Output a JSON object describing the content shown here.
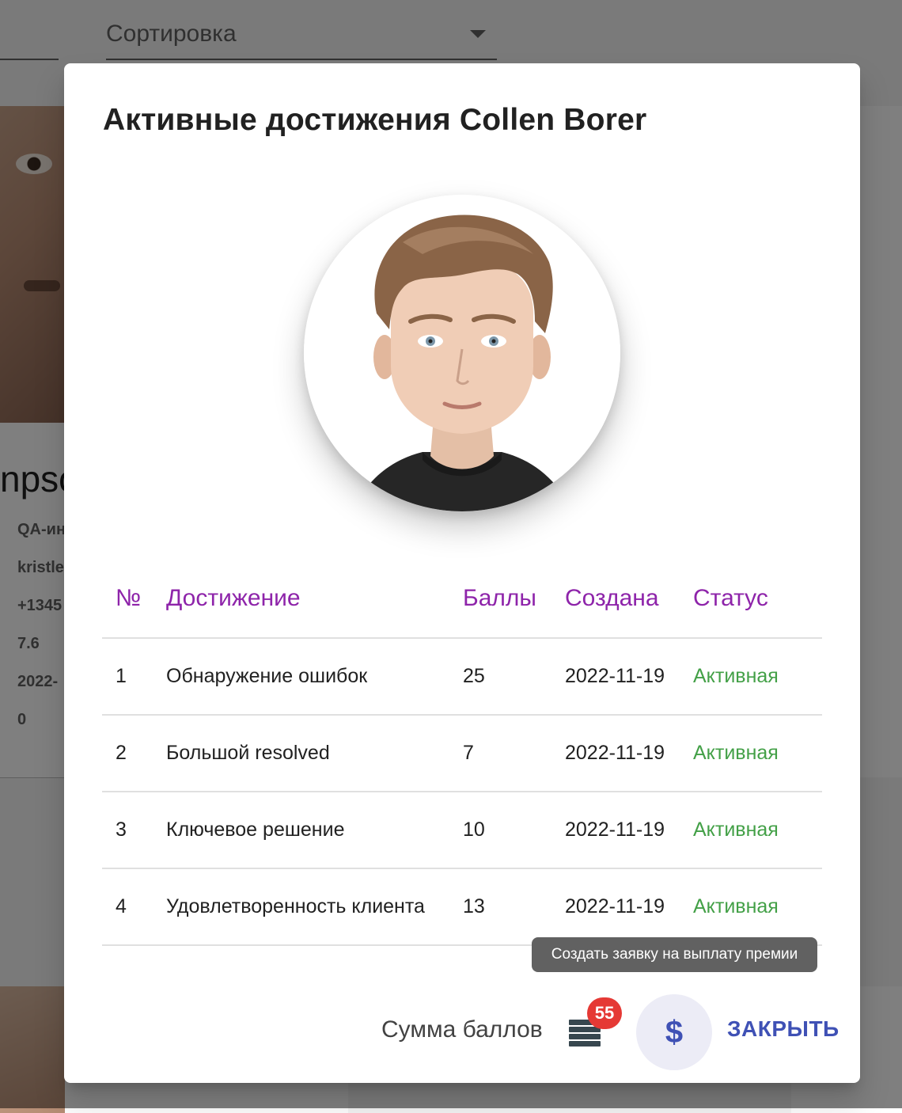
{
  "background": {
    "sort_label": "Сортировка",
    "card": {
      "name_fragment": "npso",
      "lines": [
        "QA-ин",
        "kristle",
        "+1345",
        "7.6",
        "2022-",
        "0"
      ]
    }
  },
  "dialog": {
    "title": "Активные достижения Collen Borer",
    "table": {
      "headers": [
        "№",
        "Достижение",
        "Баллы",
        "Создана",
        "Статус"
      ],
      "rows": [
        {
          "n": "1",
          "achievement": "Обнаружение ошибок",
          "points": "25",
          "created": "2022-11-19",
          "status": "Активная"
        },
        {
          "n": "2",
          "achievement": "Большой resolved",
          "points": "7",
          "created": "2022-11-19",
          "status": "Активная"
        },
        {
          "n": "3",
          "achievement": "Ключевое решение",
          "points": "10",
          "created": "2022-11-19",
          "status": "Активная"
        },
        {
          "n": "4",
          "achievement": "Удовлетворенность клиента",
          "points": "13",
          "created": "2022-11-19",
          "status": "Активная"
        }
      ]
    },
    "tooltip": "Создать заявку на выплату премии",
    "sum_label": "Сумма баллов",
    "sum_badge": "55",
    "payout_icon": "dollar-icon",
    "payout_symbol": "$",
    "close_label": "ЗАКРЫТЬ"
  },
  "colors": {
    "header_text": "#8e24aa",
    "status_active": "#43a047",
    "primary": "#3f51b5",
    "badge": "#e53935"
  }
}
